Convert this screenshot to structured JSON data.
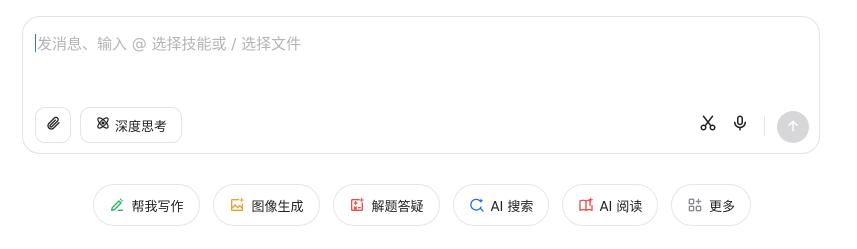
{
  "composer": {
    "placeholder": "发消息、输入 @ 选择技能或 / 选择文件",
    "deep_think_label": "深度思考",
    "icons": {
      "attach": "paperclip-icon",
      "deep_think": "atom-icon",
      "cut": "scissors-icon",
      "voice": "microphone-icon",
      "send": "arrow-up-icon"
    }
  },
  "skills": [
    {
      "label": "帮我写作",
      "icon": "pen-icon",
      "color": "#22b163"
    },
    {
      "label": "图像生成",
      "icon": "image-icon",
      "color": "#f0a020"
    },
    {
      "label": "解题答疑",
      "icon": "formula-icon",
      "color": "#ef4a4a"
    },
    {
      "label": "AI 搜索",
      "icon": "search-sparkle-icon",
      "color": "#2a6df4"
    },
    {
      "label": "AI 阅读",
      "icon": "book-icon",
      "color": "#ef4a4a"
    },
    {
      "label": "更多",
      "icon": "grid-icon",
      "color": "#8a8a92"
    }
  ]
}
